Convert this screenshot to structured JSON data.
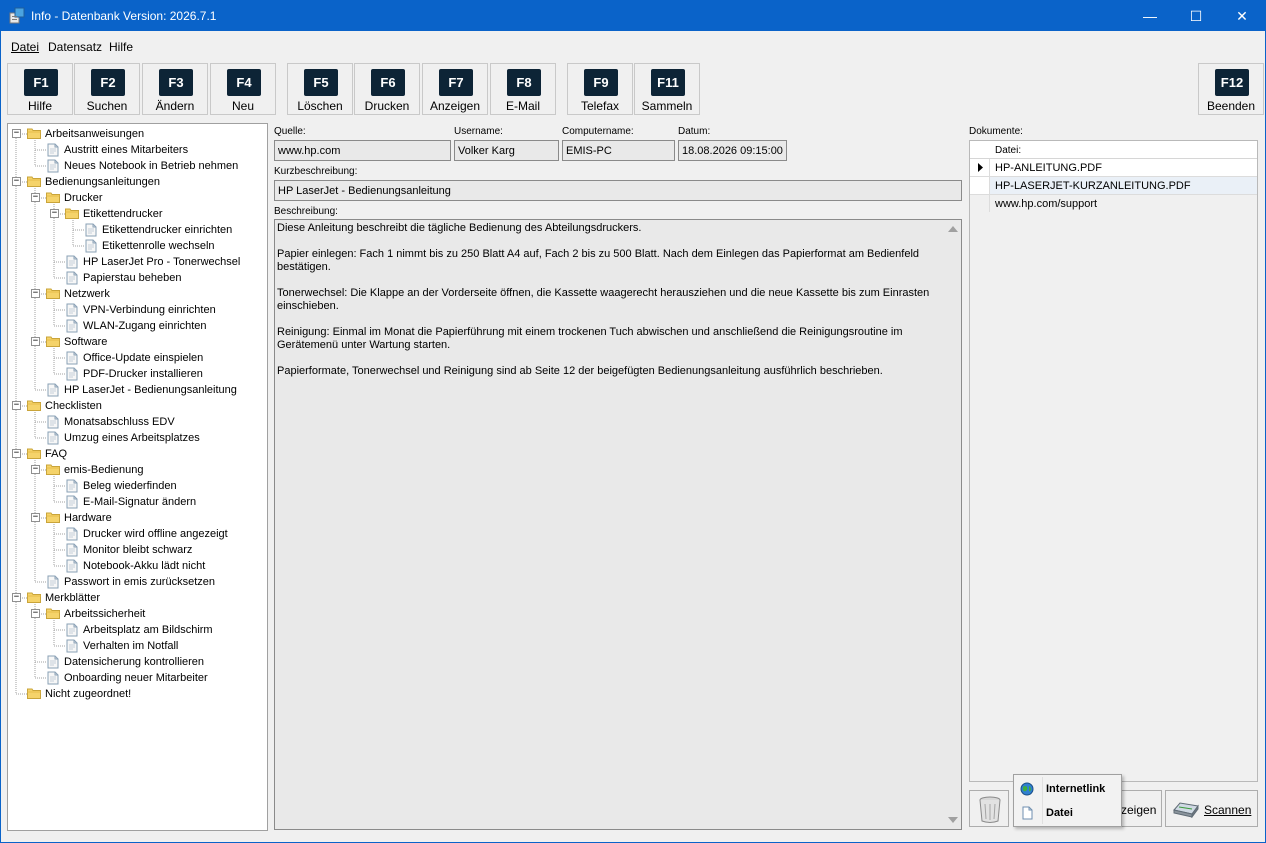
{
  "window": {
    "title": "Info - Datenbank Version: 2026.7.1",
    "controls": {
      "minimize": "—",
      "maximize": "☐",
      "close": "✕"
    }
  },
  "menu": [
    {
      "label": "Datei"
    },
    {
      "label": "Datensatz"
    },
    {
      "label": "Hilfe"
    }
  ],
  "toolbar": [
    {
      "key": "F1",
      "label": "Hilfe"
    },
    {
      "key": "F2",
      "label": "Suchen"
    },
    {
      "key": "F3",
      "label": "Ändern"
    },
    {
      "key": "F4",
      "label": "Neu"
    },
    {
      "key": "F5",
      "label": "Löschen"
    },
    {
      "key": "F6",
      "label": "Drucken"
    },
    {
      "key": "F7",
      "label": "Anzeigen"
    },
    {
      "key": "F8",
      "label": "E-Mail"
    },
    {
      "key": "F9",
      "label": "Telefax"
    },
    {
      "key": "F11",
      "label": "Sammeln"
    },
    {
      "key": "F12",
      "label": "Beenden"
    }
  ],
  "tree": [
    {
      "label": "Arbeitsanweisungen",
      "level": 0,
      "type": "folder",
      "expanded": true
    },
    {
      "label": "Austritt eines Mitarbeiters",
      "level": 1,
      "type": "doc"
    },
    {
      "label": "Neues Notebook in Betrieb nehmen",
      "level": 1,
      "type": "doc"
    },
    {
      "label": "Bedienungsanleitungen",
      "level": 0,
      "type": "folder",
      "expanded": true
    },
    {
      "label": "Drucker",
      "level": 1,
      "type": "folder",
      "expanded": true
    },
    {
      "label": "Etikettendrucker",
      "level": 2,
      "type": "folder",
      "expanded": true
    },
    {
      "label": "Etikettendrucker einrichten",
      "level": 3,
      "type": "doc"
    },
    {
      "label": "Etikettenrolle wechseln",
      "level": 3,
      "type": "doc"
    },
    {
      "label": "HP LaserJet Pro - Tonerwechsel",
      "level": 2,
      "type": "doc"
    },
    {
      "label": "Papierstau beheben",
      "level": 2,
      "type": "doc"
    },
    {
      "label": "Netzwerk",
      "level": 1,
      "type": "folder",
      "expanded": true
    },
    {
      "label": "VPN-Verbindung einrichten",
      "level": 2,
      "type": "doc"
    },
    {
      "label": "WLAN-Zugang einrichten",
      "level": 2,
      "type": "doc"
    },
    {
      "label": "Software",
      "level": 1,
      "type": "folder",
      "expanded": true
    },
    {
      "label": "Office-Update einspielen",
      "level": 2,
      "type": "doc"
    },
    {
      "label": "PDF-Drucker installieren",
      "level": 2,
      "type": "doc"
    },
    {
      "label": "HP LaserJet - Bedienungsanleitung",
      "level": 1,
      "type": "doc"
    },
    {
      "label": "Checklisten",
      "level": 0,
      "type": "folder",
      "expanded": true
    },
    {
      "label": "Monatsabschluss EDV",
      "level": 1,
      "type": "doc"
    },
    {
      "label": "Umzug eines Arbeitsplatzes",
      "level": 1,
      "type": "doc"
    },
    {
      "label": "FAQ",
      "level": 0,
      "type": "folder",
      "expanded": true
    },
    {
      "label": "emis-Bedienung",
      "level": 1,
      "type": "folder",
      "expanded": true
    },
    {
      "label": "Beleg wiederfinden",
      "level": 2,
      "type": "doc"
    },
    {
      "label": "E-Mail-Signatur ändern",
      "level": 2,
      "type": "doc"
    },
    {
      "label": "Hardware",
      "level": 1,
      "type": "folder",
      "expanded": true
    },
    {
      "label": "Drucker wird offline angezeigt",
      "level": 2,
      "type": "doc"
    },
    {
      "label": "Monitor bleibt schwarz",
      "level": 2,
      "type": "doc"
    },
    {
      "label": "Notebook-Akku lädt nicht",
      "level": 2,
      "type": "doc"
    },
    {
      "label": "Passwort in emis zurücksetzen",
      "level": 1,
      "type": "doc"
    },
    {
      "label": "Merkblätter",
      "level": 0,
      "type": "folder",
      "expanded": true
    },
    {
      "label": "Arbeitssicherheit",
      "level": 1,
      "type": "folder",
      "expanded": true
    },
    {
      "label": "Arbeitsplatz am Bildschirm",
      "level": 2,
      "type": "doc"
    },
    {
      "label": "Verhalten im Notfall",
      "level": 2,
      "type": "doc"
    },
    {
      "label": "Datensicherung kontrollieren",
      "level": 1,
      "type": "doc"
    },
    {
      "label": "Onboarding neuer Mitarbeiter",
      "level": 1,
      "type": "doc"
    },
    {
      "label": "Nicht zugeordnet!",
      "level": 0,
      "type": "folder",
      "expanded": false
    }
  ],
  "form": {
    "quelle_label": "Quelle:",
    "quelle": "www.hp.com",
    "username_label": "Username:",
    "username": "Volker Karg",
    "computer_label": "Computername:",
    "computer": "EMIS-PC",
    "datum_label": "Datum:",
    "datum": "18.08.2026 09:15:00",
    "kurz_label": "Kurzbeschreibung:",
    "kurz": "HP LaserJet - Bedienungsanleitung",
    "beschreibung_label": "Beschreibung:",
    "beschreibung": [
      "Diese Anleitung beschreibt die tägliche Bedienung des Abteilungsdruckers.",
      "Papier einlegen: Fach 1 nimmt bis zu 250 Blatt A4 auf, Fach 2 bis zu 500 Blatt. Nach dem Einlegen das Papierformat am Bedienfeld bestätigen.",
      "Tonerwechsel: Die Klappe an der Vorderseite öffnen, die Kassette waagerecht herausziehen und die neue Kassette bis zum Einrasten einschieben.",
      "Reinigung: Einmal im Monat die Papierführung mit einem trockenen Tuch abwischen und anschließend die Reinigungsroutine im Gerätemenü unter Wartung starten.",
      "Papierformate, Tonerwechsel und Reinigung sind ab Seite 12 der beigefügten Bedienungsanleitung ausführlich beschrieben."
    ]
  },
  "documents": {
    "label": "Dokumente:",
    "column": "Datei:",
    "rows": [
      {
        "file": "HP-ANLEITUNG.PDF",
        "selected": true
      },
      {
        "file": "HP-LASERJET-KURZANLEITUNG.PDF",
        "selected": false
      },
      {
        "file": "www.hp.com/support",
        "selected": false
      }
    ]
  },
  "buttons": {
    "anzeigen_partial": "zeigen",
    "scannen": "Scannen"
  },
  "popup": {
    "items": [
      {
        "label": "Internetlink",
        "icon": "globe-icon"
      },
      {
        "label": "Datei",
        "icon": "file-icon"
      }
    ]
  },
  "colors": {
    "titlebar": "#0a63c9",
    "fkey": "#0d2436",
    "field_bg": "#e9e9e9"
  }
}
